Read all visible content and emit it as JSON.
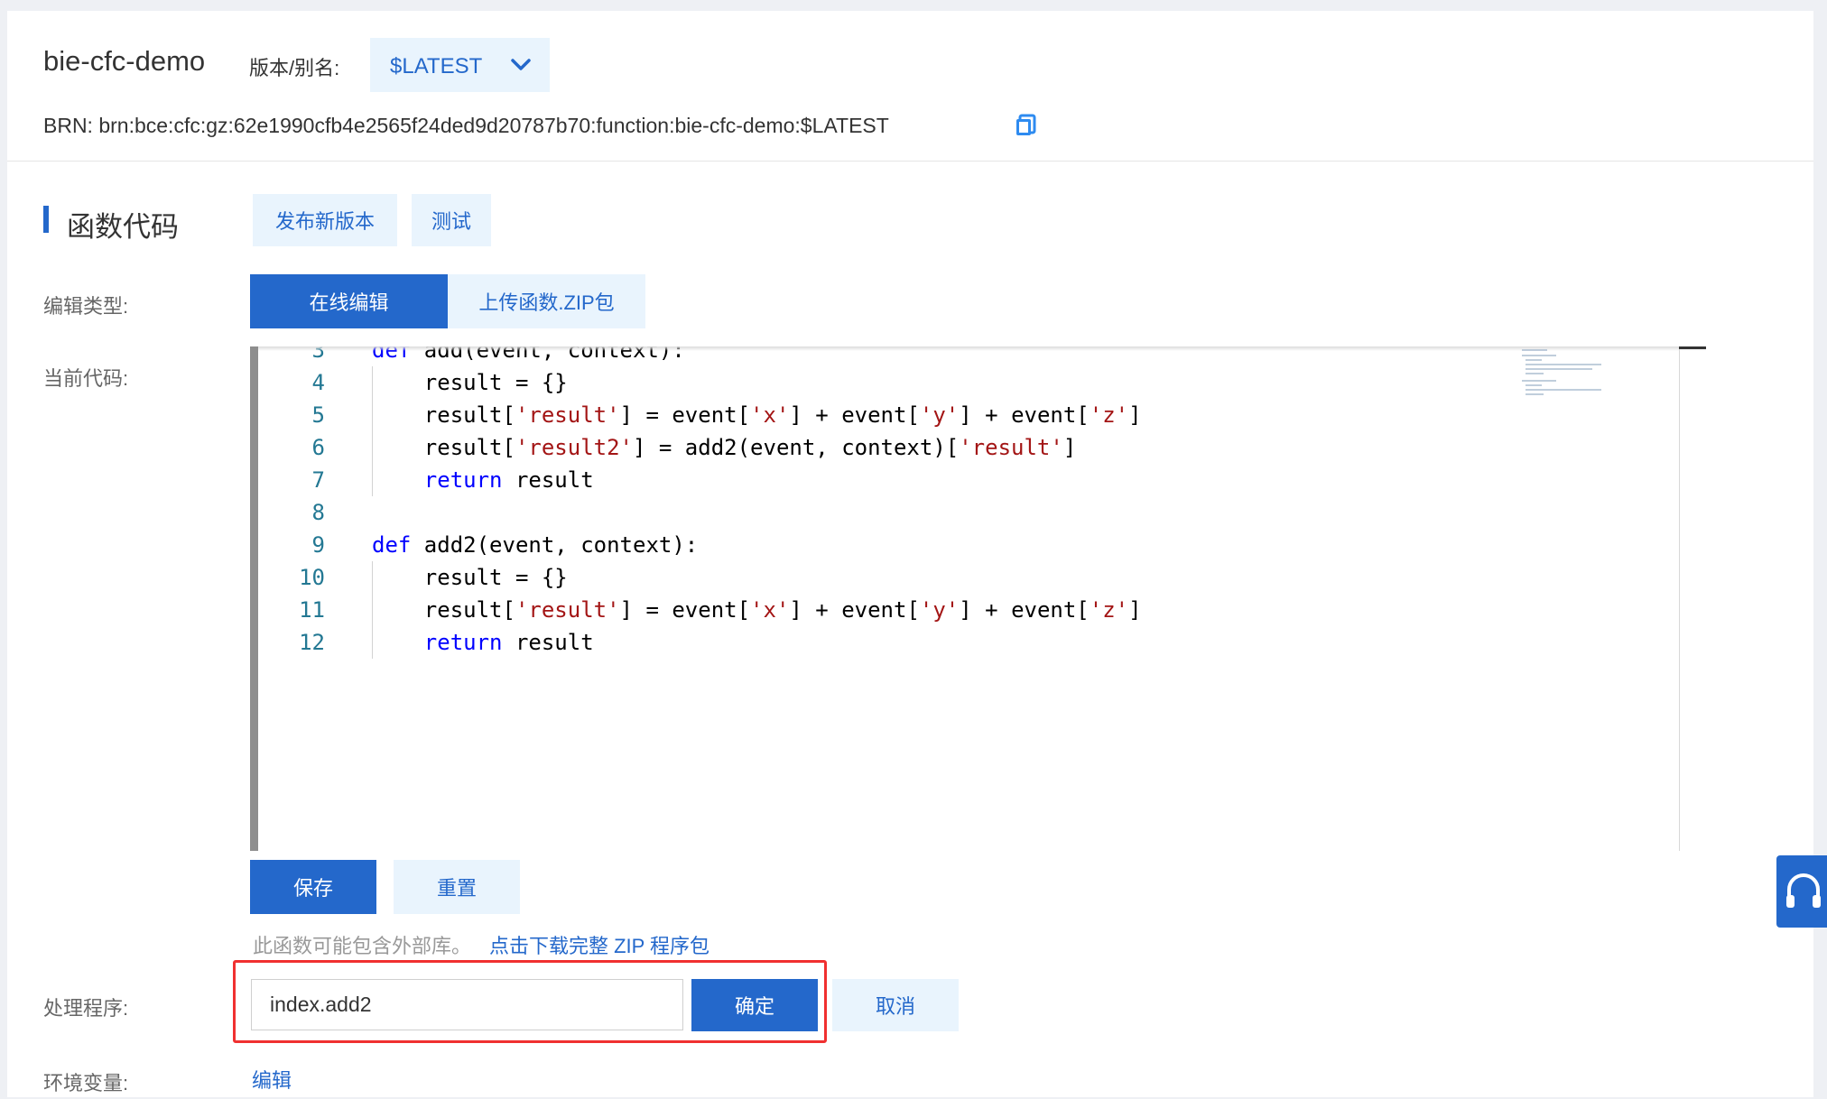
{
  "header": {
    "function_name": "bie-cfc-demo",
    "version_label": "版本/别名:",
    "version_value": "$LATEST",
    "brn_text": "BRN: brn:bce:cfc:gz:62e1990cfb4e2565f24ded9d20787b70:function:bie-cfc-demo:$LATEST"
  },
  "code_section": {
    "title": "函数代码",
    "publish_label": "发布新版本",
    "test_label": "测试",
    "edit_type_label": "编辑类型:",
    "edit_type_tabs": [
      "在线编辑",
      "上传函数.ZIP包"
    ],
    "current_code_label": "当前代码:",
    "code_lines": [
      {
        "n": "3",
        "text": "def add(event, context):"
      },
      {
        "n": "4",
        "text": "    result = {}"
      },
      {
        "n": "5",
        "text": "    result['result'] = event['x'] + event['y'] + event['z']"
      },
      {
        "n": "6",
        "text": "    result['result2'] = add2(event, context)['result']"
      },
      {
        "n": "7",
        "text": "    return result"
      },
      {
        "n": "8",
        "text": ""
      },
      {
        "n": "9",
        "text": "def add2(event, context):"
      },
      {
        "n": "10",
        "text": "    result = {}"
      },
      {
        "n": "11",
        "text": "    result['result'] = event['x'] + event['y'] + event['z']"
      },
      {
        "n": "12",
        "text": "    return result"
      }
    ],
    "save_label": "保存",
    "reset_label": "重置",
    "hint_text": "此函数可能包含外部库。",
    "hint_link": "点击下载完整 ZIP 程序包"
  },
  "handler": {
    "label": "处理程序:",
    "value": "index.add2",
    "confirm_label": "确定",
    "cancel_label": "取消"
  },
  "env": {
    "label": "环境变量:",
    "edit_label": "编辑"
  },
  "colors": {
    "primary": "#2468cb",
    "light_button_bg": "#e9f4fd",
    "highlight": "#f03030"
  },
  "icons": {
    "version_dropdown": "chevron-down-icon",
    "copy": "copy-icon",
    "support": "headset-icon"
  }
}
